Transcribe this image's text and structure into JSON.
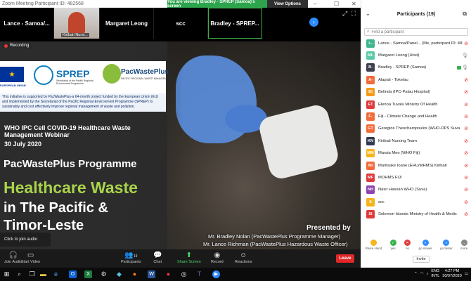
{
  "window": {
    "title": "Zoom Meeting Participant ID: 482568",
    "banner": "You are viewing Bradley - SPREP (Samoa)'s screen",
    "view_options": "View Options"
  },
  "strip": {
    "tiles": [
      "Lance - Samoa/...",
      "Kiribati Nursi...",
      "Margaret Leong",
      "scc",
      "Bradley - SPREP..."
    ]
  },
  "recording": "Recording",
  "slide": {
    "eu_caption": "EUROPEAN UNION",
    "sprep": "SPREP",
    "sprep_sub": "Secretariat of the Pacific Regional Environment Programme",
    "pwp": "PacWastePlus",
    "pwp_sub": "PACIFIC REGIONAL WASTE MANAGEMENT",
    "support_html": "This initiative is supported by PacWastePlus-a 64-month project funded by the European Union (EU) and implemented by the Secretariat of the Pacific Regional Environment Programme (SPREP) to sustainably and cost effectively improve regional management of waste and pollution.",
    "webinar": "WHO IPC Cell COVID-19 Healthcare Waste Management Webinar",
    "date": "30 July 2020",
    "programme": "PacWastePlus Programme",
    "headline1": "Healthcare Waste",
    "headline2": "in The Pacific &",
    "headline3": "Timor-Leste",
    "presented": "Presented by",
    "presenter1": "Mr. Bradley Nolan (PacWastePlus Programme Manager)",
    "presenter2": "Mr. Lance Richman (PacWastePlus Hazardous Waste Officer)"
  },
  "join_audio": "Click to join audio",
  "toolbar": {
    "audio": "Join Audio",
    "video": "Start Video",
    "participants": "Participants",
    "participants_count": "19",
    "chat": "Chat",
    "share": "Share Screen",
    "record": "Record",
    "reactions": "Reactions",
    "leave": "Leave"
  },
  "panel": {
    "title": "Participants (19)",
    "search_placeholder": "Find a participant",
    "participants": [
      {
        "initials": "L-",
        "name": "Lance - Samoa/Panel... (Me, participant ID: 482568)",
        "color": "#3fb68b"
      },
      {
        "initials": "ML",
        "name": "Margaret Leong (Host)",
        "color": "#5cc9a7"
      },
      {
        "initials": "B-",
        "name": "Bradley - SPREP (Samoa)",
        "color": "#3a3f4b"
      },
      {
        "initials": "A-",
        "name": "Alapati - Tokelau",
        "color": "#f26c3a"
      },
      {
        "initials": "B(",
        "name": "Belinda (IPC-Palau Hospital)",
        "color": "#f59b1a"
      },
      {
        "initials": "ET",
        "name": "Elenoa Tuvalu Ministry Of Health",
        "color": "#e03a3a"
      },
      {
        "initials": "F-",
        "name": "Fiji - Climate Change and Health",
        "color": "#f26c3a"
      },
      {
        "initials": "GT",
        "name": "Georgios Theocharopoulos (WHO-DPS Suva",
        "color": "#f26c3a"
      },
      {
        "initials": "KN",
        "name": "Kiribati Nursing Team",
        "color": "#2f3b52"
      },
      {
        "initials": "MM",
        "name": "Maraia Meo (WHO Fiji)",
        "color": "#f5b51a"
      },
      {
        "initials": "MI",
        "name": "Maritsake Ioane (EHU/MHMS) Kiribati",
        "color": "#f26c3a"
      },
      {
        "initials": "MF",
        "name": "MOHMS FIJI",
        "color": "#e03a3a"
      },
      {
        "initials": "NH",
        "name": "Nasir Hassan WHO (Suva)",
        "color": "#8e44ad"
      },
      {
        "initials": "S",
        "name": "scc",
        "color": "#f5b51a"
      },
      {
        "initials": "SI",
        "name": "Solomon Islands Ministry of Health & Medic",
        "color": "#e03a3a"
      }
    ],
    "reactions": [
      "Raise Hand",
      "yes",
      "no",
      "go slower",
      "go faster",
      "more"
    ],
    "invite": "Invite"
  },
  "taskbar": {
    "lang1": "ENG",
    "lang2": "INTL",
    "time": "4:27 PM",
    "date": "30/07/2020"
  }
}
